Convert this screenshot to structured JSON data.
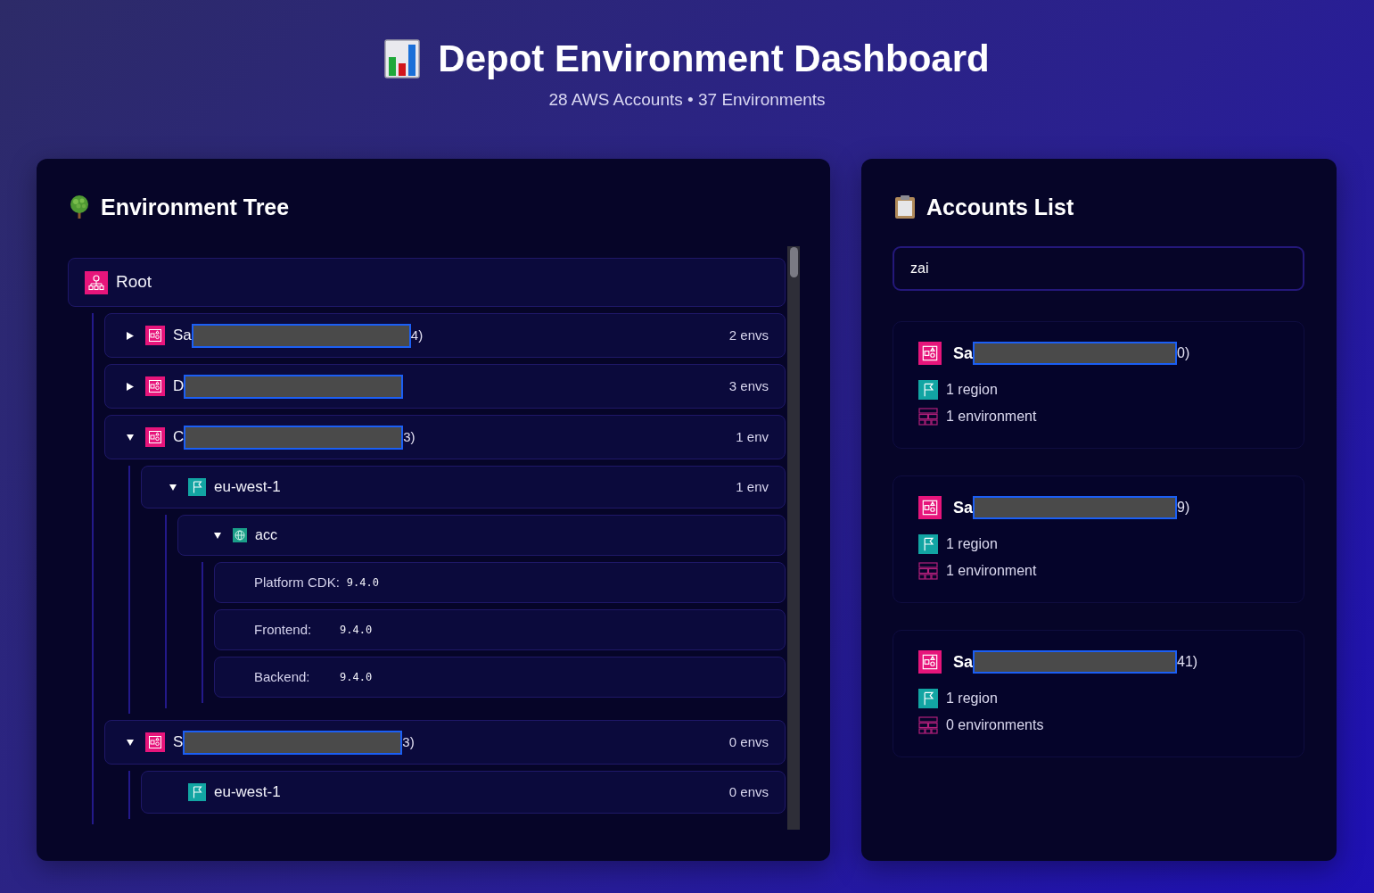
{
  "header": {
    "title": "Depot Environment Dashboard",
    "subtitle": "28 AWS Accounts • 37 Environments"
  },
  "tree": {
    "title": "Environment Tree",
    "nodes": [
      {
        "kind": "root",
        "label": "Root",
        "children": [
          {
            "kind": "account",
            "label": "Sa",
            "redacted": true,
            "label_end": "4)",
            "count": "2 envs",
            "expanded": false
          },
          {
            "kind": "account",
            "label": "D",
            "redacted": true,
            "count": "3 envs",
            "expanded": false
          },
          {
            "kind": "account",
            "label": "C",
            "redacted": true,
            "label_end": "3)",
            "count": "1 env",
            "expanded": true,
            "children": [
              {
                "kind": "region",
                "label": "eu-west-1",
                "count": "1 env",
                "expanded": true,
                "children": [
                  {
                    "kind": "environment",
                    "label": "acc",
                    "expanded": true,
                    "children": [
                      {
                        "kind": "version",
                        "label": "Platform CDK:",
                        "value": "9.4.0"
                      },
                      {
                        "kind": "version",
                        "label": "Frontend:",
                        "value": "9.4.0"
                      },
                      {
                        "kind": "version",
                        "label": "Backend:",
                        "value": "9.4.0"
                      }
                    ]
                  }
                ]
              }
            ]
          },
          {
            "kind": "account",
            "label": "S",
            "redacted": true,
            "label_end": "3)",
            "count": "0 envs",
            "expanded": true,
            "children": [
              {
                "kind": "region",
                "label": "eu-west-1",
                "count": "0 envs"
              }
            ]
          }
        ]
      }
    ]
  },
  "accounts": {
    "title": "Accounts List",
    "search": {
      "value": "zai"
    },
    "items": [
      {
        "name": "Sa",
        "redacted": true,
        "name_end": "0)",
        "regions": "1 region",
        "environments": "1 environment"
      },
      {
        "name": "Sa",
        "redacted": true,
        "name_end": "9)",
        "regions": "1 region",
        "environments": "1 environment"
      },
      {
        "name": "Sa",
        "redacted": true,
        "name_end": "41)",
        "regions": "1 region",
        "environments": "0 environments"
      }
    ]
  }
}
